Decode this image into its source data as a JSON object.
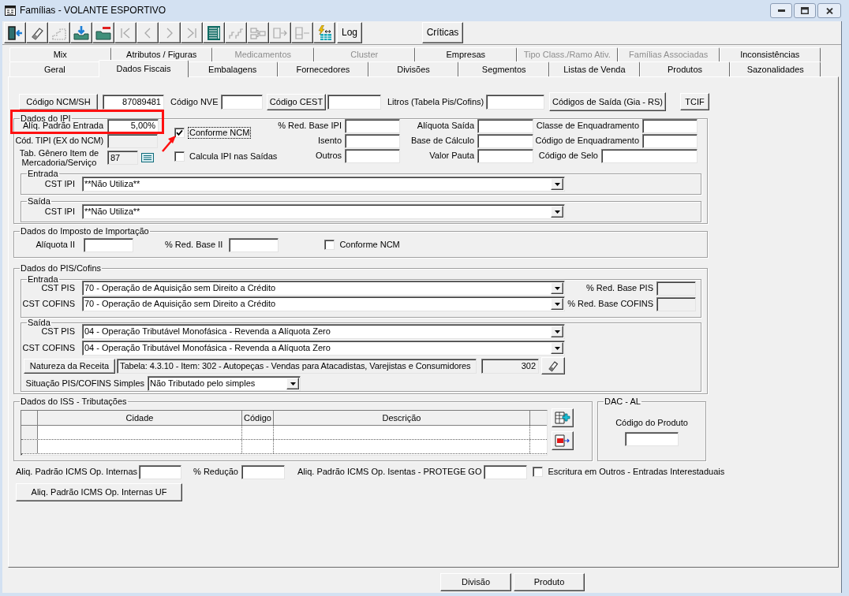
{
  "window": {
    "title": "Famílias - VOLANTE ESPORTIVO"
  },
  "toolbar": {
    "buttons": [
      {
        "kind": "icon",
        "disabled": false
      },
      {
        "kind": "icon",
        "disabled": false
      },
      {
        "kind": "icon",
        "disabled": true
      },
      {
        "kind": "icon",
        "disabled": false
      },
      {
        "kind": "icon",
        "disabled": false
      },
      {
        "kind": "icon",
        "disabled": true
      },
      {
        "kind": "icon",
        "disabled": true
      },
      {
        "kind": "icon",
        "disabled": true
      },
      {
        "kind": "icon",
        "disabled": true
      },
      {
        "kind": "icon",
        "disabled": false
      },
      {
        "kind": "icon",
        "disabled": true
      },
      {
        "kind": "icon",
        "disabled": true
      },
      {
        "kind": "icon",
        "disabled": true
      },
      {
        "kind": "icon",
        "disabled": true
      },
      {
        "kind": "icon",
        "disabled": false
      },
      {
        "kind": "text",
        "label": "Log",
        "disabled": false
      }
    ],
    "right_button": "Críticas"
  },
  "tabs": {
    "back_row": [
      {
        "label": "Mix",
        "selected": false,
        "disabled": false
      },
      {
        "label": "Atributos / Figuras",
        "selected": false,
        "disabled": false
      },
      {
        "label": "Medicamentos",
        "selected": false,
        "disabled": true
      },
      {
        "label": "Cluster",
        "selected": false,
        "disabled": true
      },
      {
        "label": "Empresas",
        "selected": false,
        "disabled": false
      },
      {
        "label": "Tipo Class./Ramo Ativ.",
        "selected": false,
        "disabled": true
      },
      {
        "label": "Famílias Associadas",
        "selected": false,
        "disabled": true
      },
      {
        "label": "Inconsistências",
        "selected": false,
        "disabled": false
      }
    ],
    "front_row": [
      {
        "label": "Geral",
        "selected": false,
        "disabled": false
      },
      {
        "label": "Dados Fiscais",
        "selected": true,
        "disabled": false
      },
      {
        "label": "Embalagens",
        "selected": false,
        "disabled": false
      },
      {
        "label": "Fornecedores",
        "selected": false,
        "disabled": false
      },
      {
        "label": "Divisões",
        "selected": false,
        "disabled": false
      },
      {
        "label": "Segmentos",
        "selected": false,
        "disabled": false
      },
      {
        "label": "Listas de Venda",
        "selected": false,
        "disabled": false
      },
      {
        "label": "Produtos",
        "selected": false,
        "disabled": false
      },
      {
        "label": "Sazonalidades",
        "selected": false,
        "disabled": false
      }
    ]
  },
  "header": {
    "ncm": {
      "button": "Código NCM/SH",
      "value": "87089481"
    },
    "nve": {
      "label": "Código NVE"
    },
    "cest": {
      "button": "Código CEST"
    },
    "litros": {
      "label": "Litros (Tabela Pis/Cofins)"
    },
    "gia_button": "Códigos de Saída (Gia - RS)",
    "tcif_button": "TCIF"
  },
  "ipi": {
    "title": "Dados do IPI",
    "aliq_entrada": {
      "label": "Alíq. Padrão Entrada",
      "value": "5,00%"
    },
    "cod_tipi": {
      "label": "Cód. TIPI (EX do NCM)",
      "disabled": true
    },
    "tab_genero": {
      "label": "Tab. Gênero Item de Mercadoria/Serviço",
      "value": "87",
      "disabled": true
    },
    "checkboxes": [
      {
        "label": "Conforme NCM",
        "checked": true,
        "focused": true
      },
      {
        "label": "Calcula IPI nas Saídas",
        "checked": false,
        "focused": false
      }
    ],
    "field_columns": [
      [
        {
          "label": "% Red. Base IPI"
        },
        {
          "label": "Isento"
        },
        {
          "label": "Outros"
        }
      ],
      [
        {
          "label": "Alíquota Saída"
        },
        {
          "label": "Base de Cálculo"
        },
        {
          "label": "Valor Pauta"
        }
      ],
      [
        {
          "label": "Classe de Enquadramento"
        },
        {
          "label": "Código de Enquadramento"
        },
        {
          "label": "Código de Selo"
        }
      ]
    ],
    "entrada": {
      "title": "Entrada",
      "label": "CST IPI",
      "value": "**Não Utiliza**"
    },
    "saida": {
      "title": "Saída",
      "label": "CST IPI",
      "value": "**Não Utiliza**"
    }
  },
  "importacao": {
    "title": "Dados do Imposto de Importação",
    "aliquota": {
      "label": "Alíquota II"
    },
    "red_base": {
      "label": "% Red. Base II"
    },
    "conforme_ncm": {
      "label": "Conforme NCM",
      "checked": false
    }
  },
  "pis_cofins": {
    "title": "Dados do PIS/Cofins",
    "entrada": {
      "title": "Entrada",
      "rows": [
        {
          "label": "CST PIS",
          "value": "70 - Operação de Aquisição sem Direito a Crédito",
          "side_field": {
            "label": "% Red. Base PIS",
            "disabled": true
          }
        },
        {
          "label": "CST COFINS",
          "value": "70 - Operação de Aquisição sem Direito a Crédito",
          "side_field": {
            "label": "% Red. Base COFINS",
            "disabled": true
          }
        }
      ]
    },
    "saida": {
      "title": "Saída",
      "rows": [
        {
          "label": "CST PIS",
          "value": "04 - Operação Tributável Monofásica - Revenda a Alíquota Zero"
        },
        {
          "label": "CST COFINS",
          "value": "04 - Operação Tributável Monofásica - Revenda a Alíquota Zero"
        }
      ],
      "natureza": {
        "button": "Natureza da Receita",
        "description": {
          "value": "Tabela: 4.3.10 - Item: 302 - Autopeças - Vendas para Atacadistas, Varejistas e Consumidores",
          "disabled": true
        },
        "code": {
          "value": "302",
          "disabled": true
        }
      },
      "simples": {
        "label": "Situação PIS/COFINS Simples",
        "value": "Não Tributado pelo simples"
      }
    }
  },
  "iss": {
    "title": "Dados do ISS - Tributações",
    "columns": [
      "Cidade",
      "Código",
      "Descrição"
    ]
  },
  "dac": {
    "title": "DAC - AL",
    "label": "Código do Produto"
  },
  "icms": {
    "internas": {
      "label": "Aliq. Padrão ICMS Op. Internas"
    },
    "reducao": {
      "label": "% Redução"
    },
    "isentas": {
      "label": "Aliq. Padrão ICMS Op. Isentas - PROTEGE GO"
    },
    "escritura": {
      "label": "Escritura em Outros - Entradas Interestaduais",
      "checked": false
    },
    "uf_button": "Aliq. Padrão ICMS Op. Internas UF"
  },
  "footer": {
    "buttons": [
      "Divisão",
      "Produto"
    ]
  }
}
